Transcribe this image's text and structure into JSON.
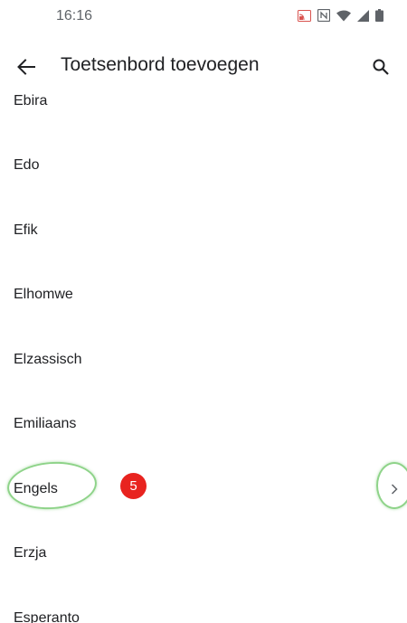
{
  "status_bar": {
    "time": "16:16",
    "icons": [
      "cast-icon",
      "nfc-icon",
      "wifi-icon",
      "signal-icon",
      "battery-icon"
    ]
  },
  "app_bar": {
    "title": "Toetsenbord toevoegen",
    "back_icon": "arrow-back-icon",
    "search_icon": "search-icon"
  },
  "languages": [
    {
      "label": "Ebira"
    },
    {
      "label": "Edo"
    },
    {
      "label": "Efik"
    },
    {
      "label": "Elhomwe"
    },
    {
      "label": "Elzassisch"
    },
    {
      "label": "Emiliaans"
    },
    {
      "label": "Engels",
      "has_chevron": true
    },
    {
      "label": "Erzja"
    },
    {
      "label": "Esperanto"
    }
  ],
  "annotation": {
    "step_number": "5",
    "highlight_color": "#8ed389",
    "badge_color": "#e8231f"
  }
}
